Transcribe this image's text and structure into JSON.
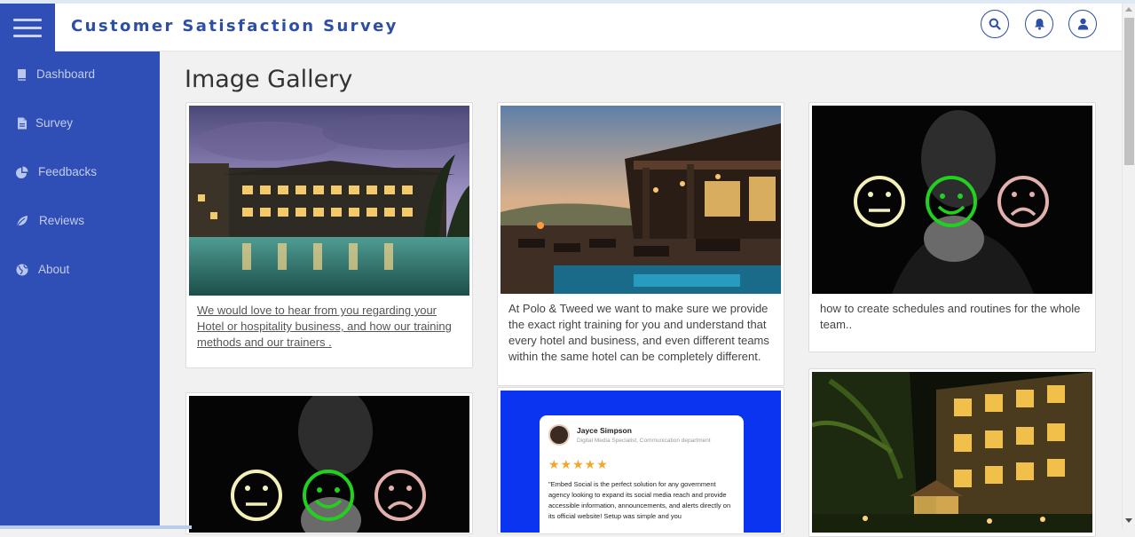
{
  "header": {
    "title": "Customer Satisfaction Survey",
    "menu_icon": "hamburger-menu-icon",
    "actions": [
      {
        "icon": "search-icon"
      },
      {
        "icon": "bell-icon"
      },
      {
        "icon": "user-icon"
      }
    ]
  },
  "sidebar": {
    "items": [
      {
        "label": "Dashboard",
        "icon": "book-icon"
      },
      {
        "label": "Survey",
        "icon": "file-icon"
      },
      {
        "label": "Feedbacks",
        "icon": "chart-pie-icon"
      },
      {
        "label": "Reviews",
        "icon": "leaf-icon"
      },
      {
        "label": "About",
        "icon": "globe-icon"
      }
    ]
  },
  "gallery": {
    "title": "Image Gallery",
    "cards": [
      {
        "caption": "We would love to hear from you regarding your Hotel or hospitality business, and how our training methods and our trainers ."
      },
      {
        "caption": "At Polo & Tweed we want to make sure we provide the exact right training for you and understand that every hotel and business, and even different teams within the same hotel can be completely different."
      },
      {
        "caption": "how to create schedules and routines for the whole team.."
      },
      {
        "caption": ""
      },
      {
        "caption": ""
      },
      {
        "caption": ""
      }
    ],
    "review_card": {
      "name": "Jayce Simpson",
      "role": "Digital Media Specialist, Communication department",
      "stars": "★★★★★",
      "rating": 5,
      "text": "\"Embed Social is the perfect solution for any government agency looking to expand its social media reach and provide accessible information, announcements, and alerts directly on its official website! Setup was simple and you"
    }
  },
  "colors": {
    "brand": "#2f4fb6",
    "title": "#2c4da8",
    "background": "#f1f1f1"
  }
}
